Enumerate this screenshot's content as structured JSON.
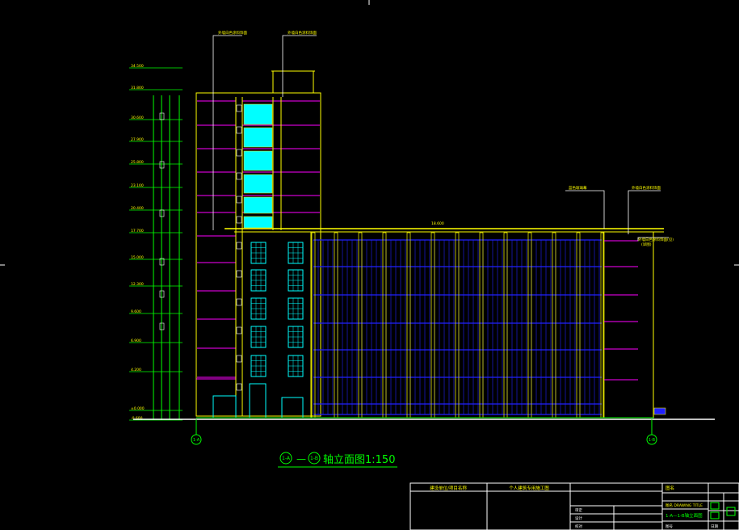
{
  "drawing": {
    "title_axis_start": "1-A",
    "title_axis_end": "1-B",
    "title_dash": "—",
    "title_text": "轴立面图1:150",
    "grid_bubble_left": "1-A",
    "grid_bubble_right": "1-B"
  },
  "elevation_marks": [
    "34.500",
    "31.800",
    "30.600",
    "27.900",
    "25.800",
    "23.100",
    "20.400",
    "17.700",
    "15.000",
    "12.300",
    "9.600",
    "6.900",
    "4.200",
    "±0.000",
    "-0.600"
  ],
  "leaders": {
    "top_left": "外墙白色涂料饰面",
    "top_mid": "外墙白色涂料饰面",
    "right_a": "蓝色玻璃幕",
    "right_b": "外墙白色涂料饰面",
    "right_side": "外墙白色涂料饰面(见)",
    "right_side_2": "(详图)",
    "roof_level": "18.600"
  },
  "title_block": {
    "header_a": "建设单位/项目名称",
    "header_b": "个人建筑专用施工图",
    "right_header": "图名",
    "drawing_title_label": "图名 DRAWING TITLE",
    "drawing_title_value": "1-A—1-B轴立面图",
    "cell_a": "审定",
    "cell_b": "设计",
    "cell_c": "校对",
    "side_a": "图号",
    "side_b": "日期"
  },
  "colors": {
    "cad_yellow": "#ffff00",
    "cad_green": "#00ff00",
    "cad_cyan": "#00ffff",
    "cad_magenta": "#ff00ff",
    "cad_blue": "#2020ff",
    "cad_white": "#ffffff"
  }
}
